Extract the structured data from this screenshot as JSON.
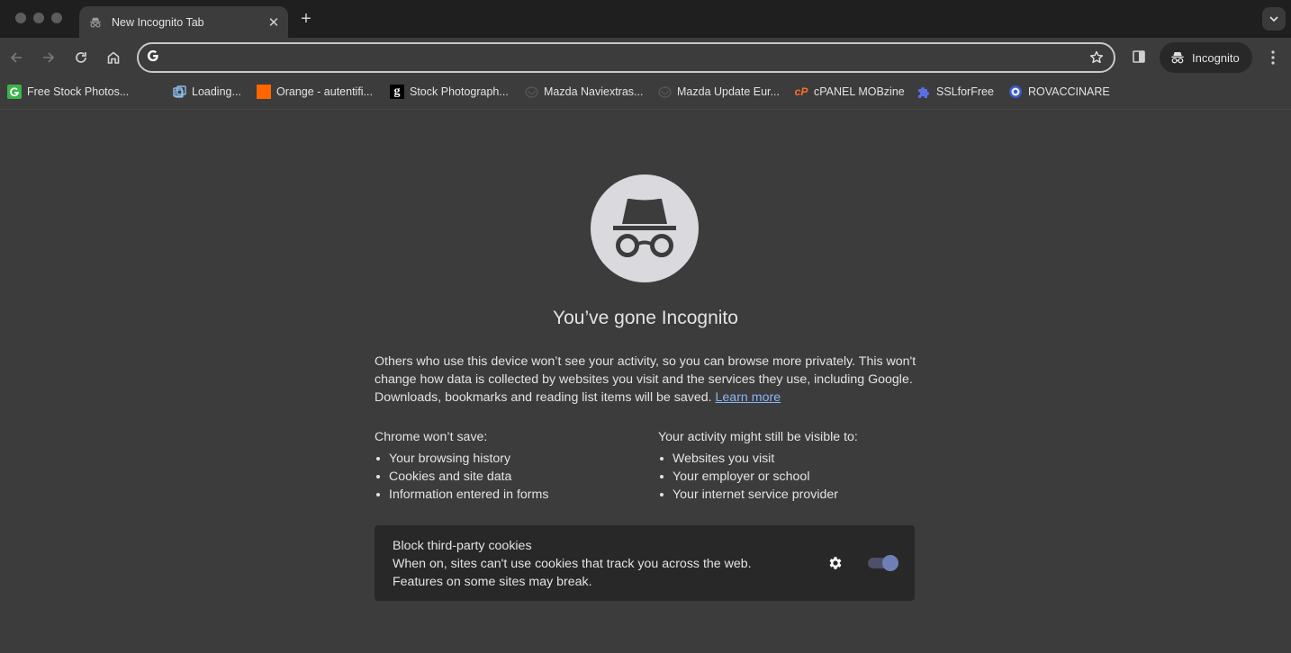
{
  "window": {
    "tab": {
      "title": "New Incognito Tab",
      "icon": "incognito-icon"
    },
    "new_tab_symbol": "+",
    "close_symbol": "✕"
  },
  "toolbar": {
    "omnibox": {
      "value": "",
      "placeholder": "",
      "icon": "google-g-icon"
    },
    "profile_chip_label": "Incognito"
  },
  "bookmarks": [
    {
      "label": "Free Stock Photos...",
      "icon": "freepik-icon",
      "color": "#3bb54a"
    },
    {
      "label": "Loading...",
      "icon": "loading-globe-icon",
      "color": "#6aa6e8"
    },
    {
      "label": "Orange - autentifi...",
      "icon": "orange-icon",
      "color": "#ff6600"
    },
    {
      "label": "Stock Photograph...",
      "icon": "getty-g-icon",
      "color": "#000000"
    },
    {
      "label": "Mazda Naviextras...",
      "icon": "mazda-icon",
      "color": "#555555"
    },
    {
      "label": "Mazda Update Eur...",
      "icon": "mazda-icon",
      "color": "#555555"
    },
    {
      "label": "cPANEL MOBzine",
      "icon": "cpanel-icon",
      "color": "#ff6c2c"
    },
    {
      "label": "SSLforFree",
      "icon": "puzzle-icon",
      "color": "#5b6ee1"
    },
    {
      "label": "ROVACCINARE",
      "icon": "ro-gov-icon",
      "color": "#3b5cc4"
    }
  ],
  "content": {
    "heading": "You’ve gone Incognito",
    "paragraph": "Others who use this device won’t see your activity, so you can browse more privately. This won't change how data is collected by websites you visit and the services they use, including Google. Downloads, bookmarks and reading list items will be saved.",
    "learn_more": "Learn more",
    "wont_save": {
      "title": "Chrome won’t save:",
      "items": [
        "Your browsing history",
        "Cookies and site data",
        "Information entered in forms"
      ]
    },
    "visible_to": {
      "title": "Your activity might still be visible to:",
      "items": [
        "Websites you visit",
        "Your employer or school",
        "Your internet service provider"
      ]
    },
    "cookies": {
      "title": "Block third-party cookies",
      "line1": "When on, sites can't use cookies that track you across the web.",
      "line2": "Features on some sites may break.",
      "toggle_on": true
    }
  }
}
